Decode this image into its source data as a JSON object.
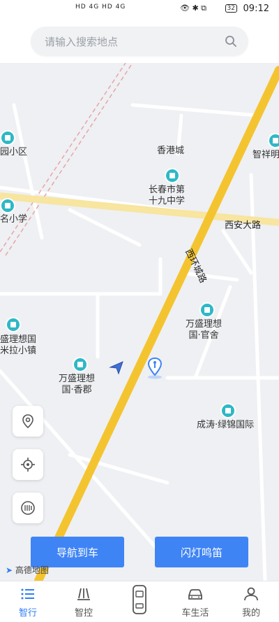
{
  "status_bar": {
    "network_left": "HD 4G HD 4G",
    "battery": "32",
    "time": "09:12"
  },
  "search": {
    "placeholder": "请输入搜索地点"
  },
  "map": {
    "labels": {
      "xianggang_city": "香港城",
      "school": "长春市第\n十九中学",
      "zhixiang": "智祥明",
      "garden": "园小区",
      "primary": "名小学",
      "xian_road": "西安大路",
      "xihuan_road": "西环城路",
      "wansheng_guanshe": "万盛理想\n国·官舍",
      "wansheng_milan": "盛理想国\n米拉小镇",
      "wansheng_xiangjun": "万盛理想\n国·香郡",
      "chengtao": "成涛·绿锦国际"
    },
    "brand": "高德地图"
  },
  "actions": {
    "navigate": "导航到车",
    "flash": "闪灯鸣笛"
  },
  "tabs": [
    {
      "label": "智行",
      "active": true
    },
    {
      "label": "智控"
    },
    {
      "label": ""
    },
    {
      "label": "车生活"
    },
    {
      "label": "我的"
    }
  ],
  "colors": {
    "accent": "#3f84f4",
    "road_main": "#f4c430",
    "poi": "#2eb8c6"
  }
}
